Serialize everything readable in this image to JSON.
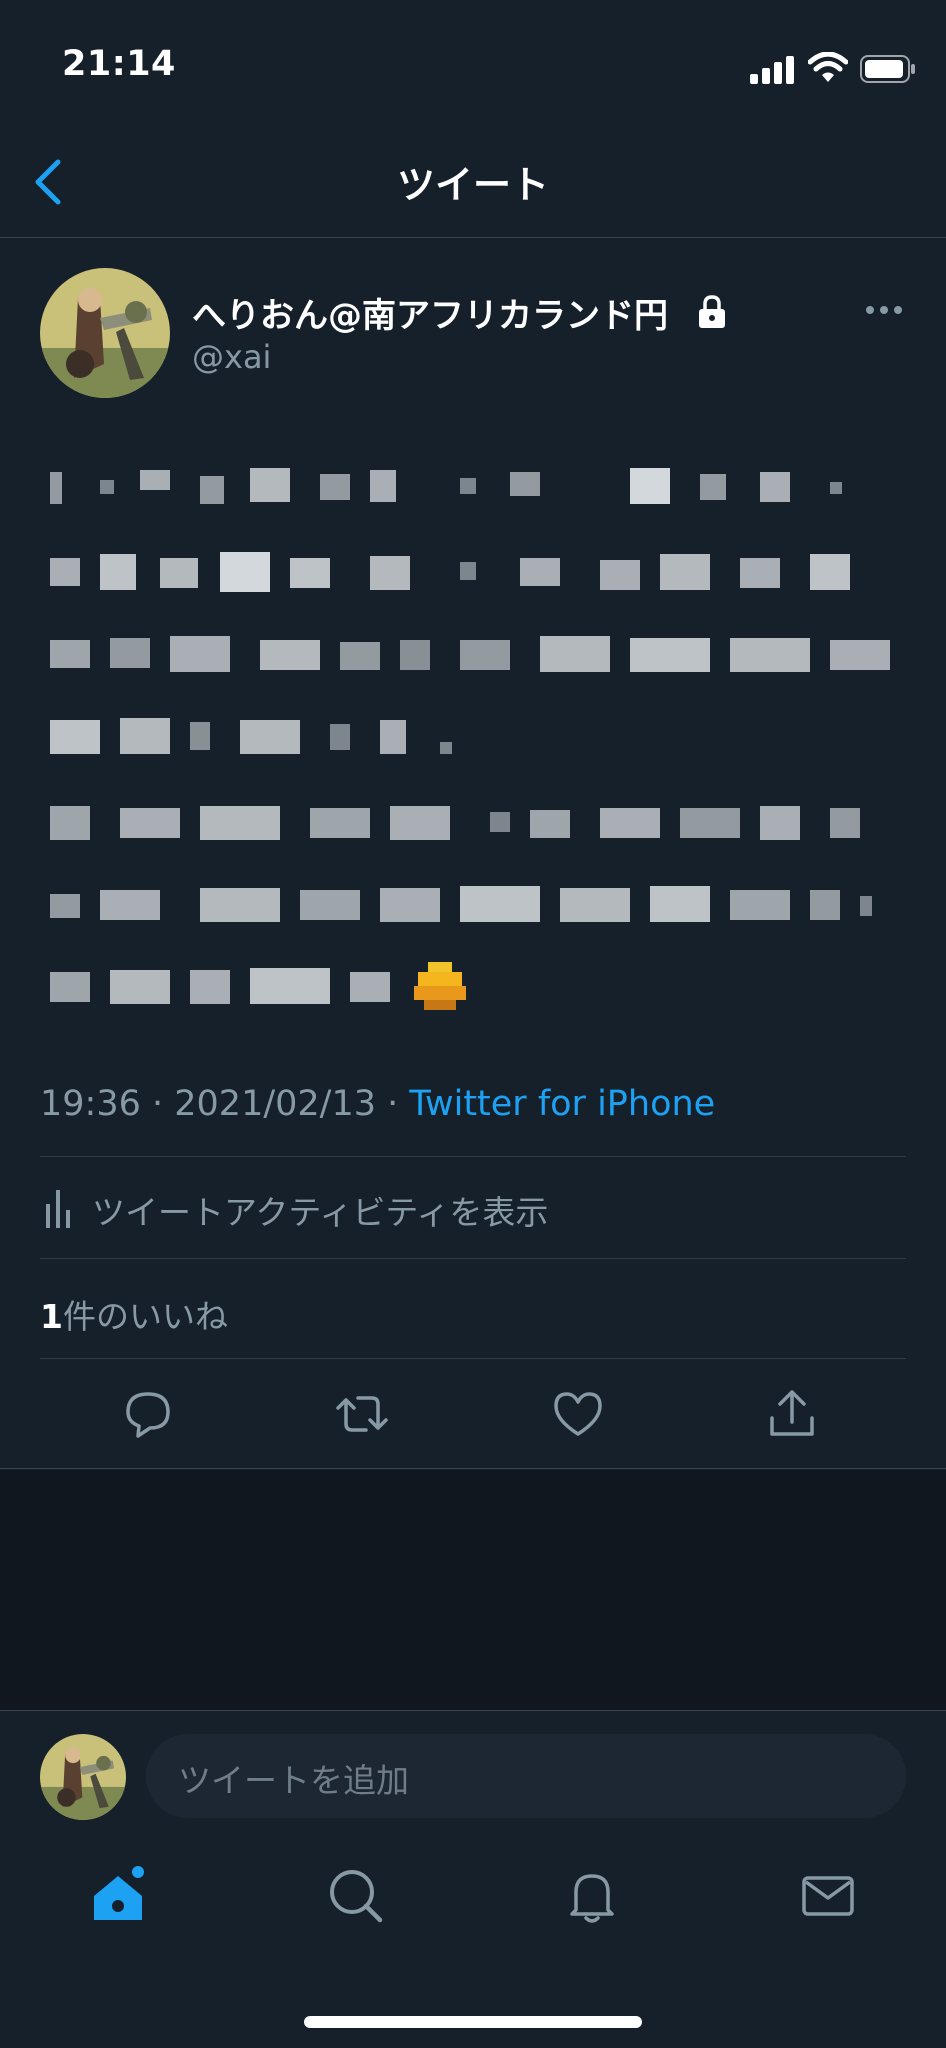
{
  "status_bar": {
    "time": "21:14"
  },
  "nav": {
    "title": "ツイート"
  },
  "author": {
    "name": "へりおん@南アフリカランド円",
    "handle": "@xai"
  },
  "tweet": {
    "time": "19:36",
    "date": "2021/02/13",
    "separator": " · ",
    "source": "Twitter for iPhone"
  },
  "activity": {
    "label": "ツイートアクティビティを表示"
  },
  "likes": {
    "count": "1",
    "label": "件のいいね"
  },
  "reply": {
    "placeholder": "ツイートを追加"
  },
  "colors": {
    "background": "#15202b",
    "accent": "#1da1f2",
    "secondary_text": "#8899a6",
    "divider": "#38444d"
  },
  "icons": {
    "back": "chevron-left-icon",
    "more": "more-icon",
    "lock": "lock-icon",
    "reply": "reply-icon",
    "retweet": "retweet-icon",
    "like": "heart-icon",
    "share": "share-icon",
    "home": "home-icon",
    "search": "search-icon",
    "notifications": "bell-icon",
    "messages": "mail-icon"
  }
}
